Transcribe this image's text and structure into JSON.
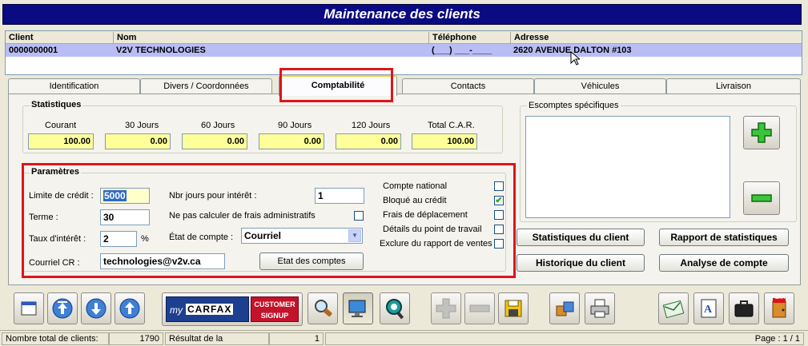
{
  "window": {
    "title": "Maintenance des clients"
  },
  "grid": {
    "headers": [
      "Client",
      "Nom",
      "Téléphone",
      "Adresse"
    ],
    "row": {
      "client": "0000000001",
      "nom": "V2V TECHNOLOGIES",
      "telephone": "(___) ___-____",
      "adresse": "2620 AVENUE DALTON #103"
    }
  },
  "tabs": [
    {
      "label": "Identification"
    },
    {
      "label": "Divers / Coordonnées"
    },
    {
      "label": "Comptabilité",
      "active": true
    },
    {
      "label": "Contacts"
    },
    {
      "label": "Véhicules"
    },
    {
      "label": "Livraison"
    }
  ],
  "statistiques": {
    "title": "Statistiques",
    "columns": [
      {
        "label": "Courant",
        "value": "100.00"
      },
      {
        "label": "30 Jours",
        "value": "0.00"
      },
      {
        "label": "60 Jours",
        "value": "0.00"
      },
      {
        "label": "90 Jours",
        "value": "0.00"
      },
      {
        "label": "120 Jours",
        "value": "0.00"
      },
      {
        "label": "Total C.A.R.",
        "value": "100.00"
      }
    ]
  },
  "escomptes": {
    "title": "Escomptes spécifiques"
  },
  "parametres": {
    "title": "Paramètres",
    "limite_label": "Limite de crédit :",
    "limite_value": "5000",
    "terme_label": "Terme :",
    "terme_value": "30",
    "taux_label": "Taux d'intérêt :",
    "taux_value": "2",
    "taux_unit": "%",
    "courriel_label": "Courriel CR :",
    "courriel_value": "technologies@v2v.ca",
    "nbjours_label": "Nbr jours pour intérêt :",
    "nbjours_value": "1",
    "frais_label": "Ne pas calculer de frais administratifs",
    "etat_label": "État de compte :",
    "etat_value": "Courriel",
    "etat_button": "Etat des comptes",
    "checks": [
      {
        "label": "Compte national",
        "checked": false
      },
      {
        "label": "Bloqué au crédit",
        "checked": true
      },
      {
        "label": "Frais de déplacement",
        "checked": false
      },
      {
        "label": "Détails du point de travail",
        "checked": false
      },
      {
        "label": "Exclure du rapport de ventes",
        "checked": false
      }
    ]
  },
  "buttons": {
    "stats_client": "Statistiques du client",
    "rapport_stats": "Rapport de statistiques",
    "historique": "Historique du client",
    "analyse": "Analyse de compte"
  },
  "carfax": {
    "brand": "CARFAX",
    "prefix": "my",
    "line1": "CUSTOMER",
    "line2": "SIGNUP"
  },
  "exit_label": "EXIT",
  "status": {
    "total_label": "Nombre total de clients:",
    "total_value": "1790",
    "result_label": "Résultat de la recherche:",
    "result_value": "1",
    "page": "Page : 1 / 1"
  },
  "colors": {
    "title_bar": "#0a0a82",
    "highlight": "#e0141b",
    "selected_row": "#b9bdf5",
    "yellow_field": "#ffff99"
  }
}
